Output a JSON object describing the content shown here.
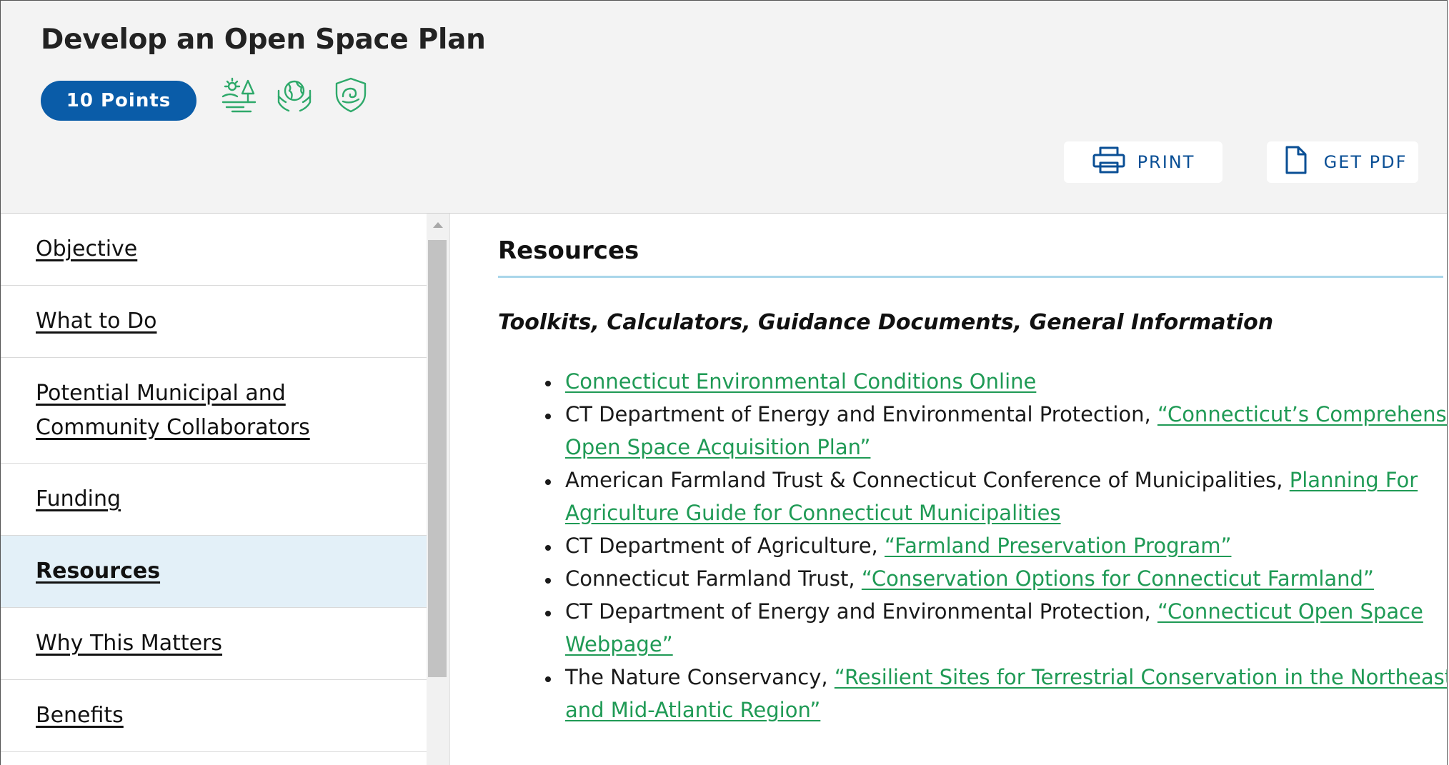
{
  "header": {
    "title": "Develop an Open Space Plan",
    "points_badge": "10 Points",
    "category_icons": [
      "landscape-trees-icon",
      "hands-globe-icon",
      "shield-water-icon"
    ],
    "print_label": "PRINT",
    "pdf_label": "GET PDF"
  },
  "sidebar": {
    "items": [
      {
        "label": "Objective",
        "active": false
      },
      {
        "label": "What to Do",
        "active": false
      },
      {
        "label": "Potential Municipal and Community Collaborators",
        "active": false
      },
      {
        "label": "Funding",
        "active": false
      },
      {
        "label": "Resources",
        "active": true
      },
      {
        "label": "Why This Matters",
        "active": false
      },
      {
        "label": "Benefits",
        "active": false
      }
    ]
  },
  "content": {
    "heading": "Resources",
    "subheading": "Toolkits, Calculators, Guidance Documents, General Information",
    "resources": [
      {
        "prefix": "",
        "link": "Connecticut Environmental Conditions Online"
      },
      {
        "prefix": "CT Department of Energy and Environmental Protection, ",
        "link": "“Connecticut’s Comprehensive Open Space Acquisition Plan”"
      },
      {
        "prefix": "American Farmland Trust & Connecticut Conference of Municipalities, ",
        "link": "Planning For Agriculture Guide for Connecticut Municipalities"
      },
      {
        "prefix": "CT Department of Agriculture, ",
        "link": "“Farmland Preservation Program”"
      },
      {
        "prefix": "Connecticut Farmland Trust, ",
        "link": "“Conservation Options for Connecticut Farmland”"
      },
      {
        "prefix": "CT Department of Energy and Environmental Protection, ",
        "link": "“Connecticut Open Space Webpage”"
      },
      {
        "prefix": "The Nature Conservancy, ",
        "link": "“Resilient Sites for Terrestrial Conservation in the Northeast and Mid-Atlantic Region”"
      }
    ]
  },
  "colors": {
    "badge_blue": "#0a5ca8",
    "icon_green": "#2ea96a",
    "link_green": "#1f9a55",
    "button_text": "#0a4f95",
    "active_nav_bg": "#e3f0f8",
    "rule_blue": "#a9d6ea"
  }
}
